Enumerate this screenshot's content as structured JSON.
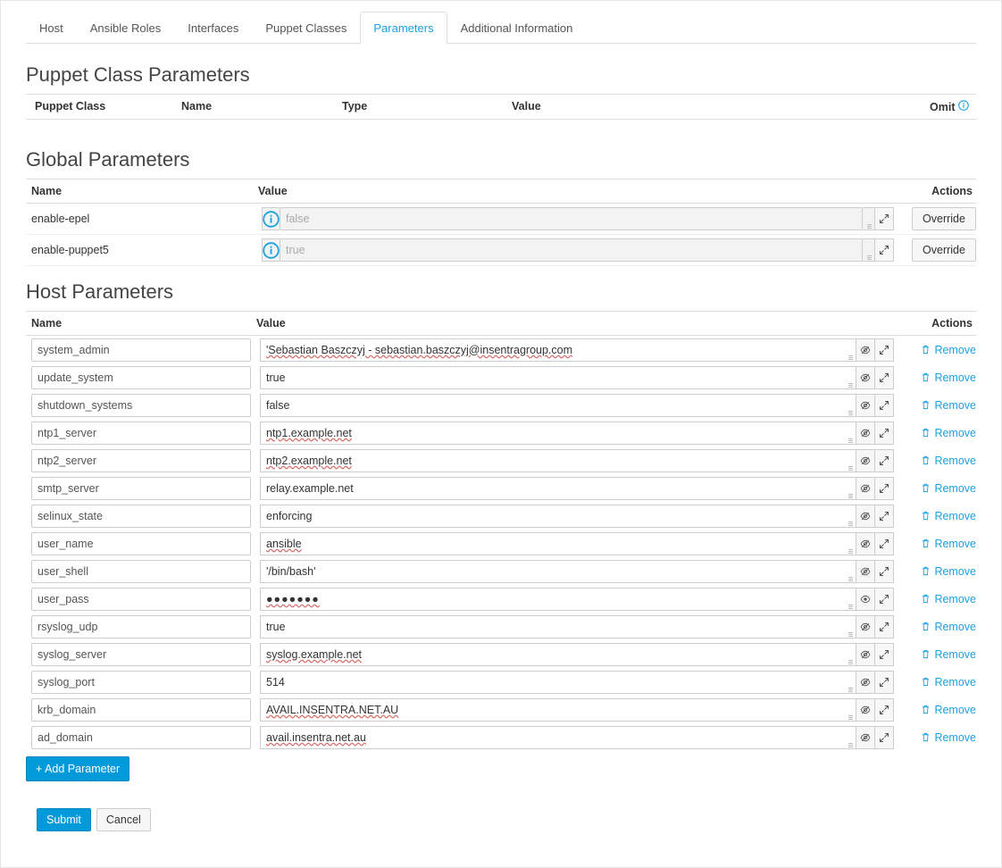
{
  "tabs": [
    "Host",
    "Ansible Roles",
    "Interfaces",
    "Puppet Classes",
    "Parameters",
    "Additional Information"
  ],
  "active_tab": 4,
  "sections": {
    "puppet_class": "Puppet Class Parameters",
    "global": "Global Parameters",
    "host": "Host Parameters"
  },
  "puppet_headers": {
    "class": "Puppet Class",
    "name": "Name",
    "type": "Type",
    "value": "Value",
    "omit": "Omit"
  },
  "global_headers": {
    "name": "Name",
    "value": "Value",
    "actions": "Actions"
  },
  "host_headers": {
    "name": "Name",
    "value": "Value",
    "actions": "Actions"
  },
  "global_params": [
    {
      "name": "enable-epel",
      "value": "false"
    },
    {
      "name": "enable-puppet5",
      "value": "true"
    }
  ],
  "host_params": [
    {
      "name": "system_admin",
      "value": "'Sebastian Baszczyj - sebastian.baszczyj@insentragroup.com",
      "spell": true
    },
    {
      "name": "update_system",
      "value": "true"
    },
    {
      "name": "shutdown_systems",
      "value": "false"
    },
    {
      "name": "ntp1_server",
      "value": "ntp1.example.net",
      "spell": true
    },
    {
      "name": "ntp2_server",
      "value": "ntp2.example.net",
      "spell": true
    },
    {
      "name": "smtp_server",
      "value": "relay.example.net"
    },
    {
      "name": "selinux_state",
      "value": "enforcing"
    },
    {
      "name": "user_name",
      "value": "ansible",
      "spell": true
    },
    {
      "name": "user_shell",
      "value": "'/bin/bash'"
    },
    {
      "name": "user_pass",
      "value": "●●●●●●●",
      "masked": true,
      "spell": true
    },
    {
      "name": "rsyslog_udp",
      "value": "true"
    },
    {
      "name": "syslog_server",
      "value": "syslog.example.net",
      "spell": true
    },
    {
      "name": "syslog_port",
      "value": "514"
    },
    {
      "name": "krb_domain",
      "value": "AVAIL.INSENTRA.NET.AU",
      "spell": true
    },
    {
      "name": "ad_domain",
      "value": "avail.insentra.net.au",
      "spell": true
    }
  ],
  "labels": {
    "override": "Override",
    "remove": "Remove",
    "add_param": "+ Add Parameter",
    "submit": "Submit",
    "cancel": "Cancel"
  }
}
